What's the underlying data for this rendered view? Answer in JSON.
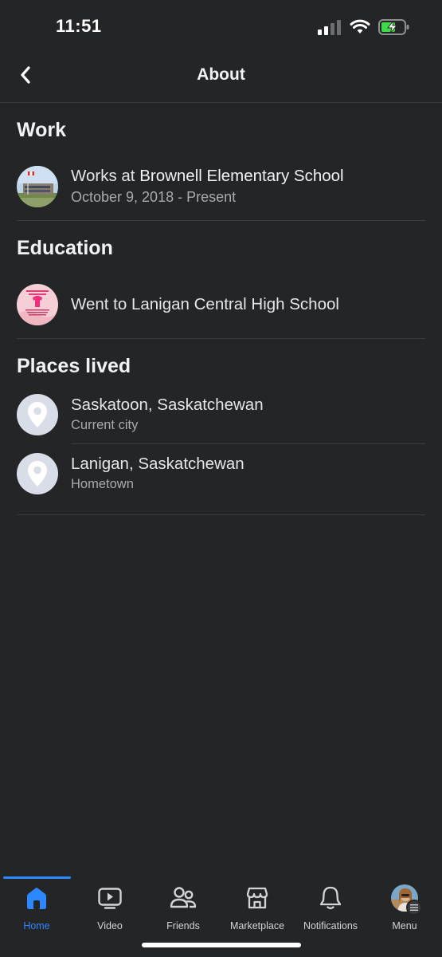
{
  "status_bar": {
    "time": "11:51"
  },
  "header": {
    "title": "About"
  },
  "sections": {
    "work": {
      "title": "Work",
      "items": [
        {
          "prefix": "Works at ",
          "name": "Brownell Elementary School",
          "secondary": "October 9, 2018 - Present"
        }
      ]
    },
    "education": {
      "title": "Education",
      "items": [
        {
          "text": "Went to Lanigan Central High School"
        }
      ]
    },
    "places": {
      "title": "Places lived",
      "items": [
        {
          "name": "Saskatoon, Saskatchewan",
          "label": "Current city"
        },
        {
          "name": "Lanigan, Saskatchewan",
          "label": "Hometown"
        }
      ]
    }
  },
  "bottom_nav": {
    "items": [
      {
        "label": "Home",
        "icon": "home-icon",
        "active": true
      },
      {
        "label": "Video",
        "icon": "video-icon",
        "active": false
      },
      {
        "label": "Friends",
        "icon": "friends-icon",
        "active": false
      },
      {
        "label": "Marketplace",
        "icon": "marketplace-icon",
        "active": false
      },
      {
        "label": "Notifications",
        "icon": "bell-icon",
        "active": false
      },
      {
        "label": "Menu",
        "icon": "profile-avatar",
        "active": false
      }
    ]
  },
  "colors": {
    "background": "#242526",
    "accent": "#2d88ff",
    "text_primary": "#e4e6eb",
    "text_secondary": "#a8abaf",
    "divider": "#3a3b3c"
  }
}
